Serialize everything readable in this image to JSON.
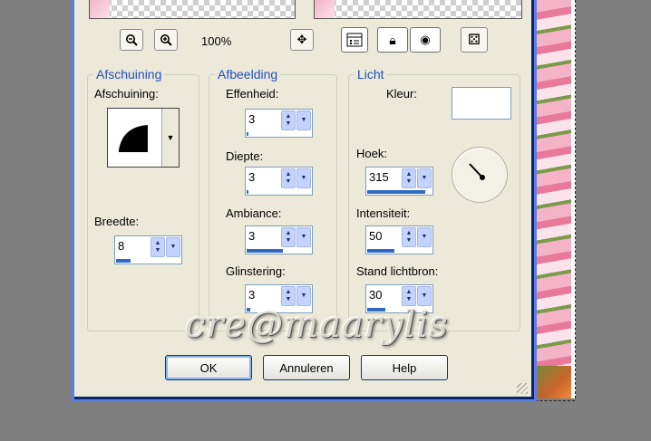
{
  "toolbar": {
    "zoom_level": "100%",
    "icons": [
      "zoom-out-icon",
      "zoom-in-icon",
      "move-icon",
      "proof-icon",
      "lock-eye-icon",
      "eye-icon",
      "random-dice-icon"
    ]
  },
  "bevel_group": {
    "title": "Afschuining",
    "shape_label": "Afschuining:",
    "width_label": "Breedte:",
    "width_value": "8"
  },
  "image_group": {
    "title": "Afbeelding",
    "smoothness_label": "Effenheid:",
    "smoothness_value": "3",
    "depth_label": "Diepte:",
    "depth_value": "3",
    "ambiance_label": "Ambiance:",
    "ambiance_value": "3",
    "shininess_label": "Glinstering:",
    "shininess_value": "3"
  },
  "light_group": {
    "title": "Licht",
    "color_label": "Kleur:",
    "color_value": "#ffffff",
    "angle_label": "Hoek:",
    "angle_value": "315",
    "intensity_label": "Intensiteit:",
    "intensity_value": "50",
    "elevation_label": "Stand lichtbron:",
    "elevation_value": "30"
  },
  "buttons": {
    "ok": "OK",
    "cancel": "Annuleren",
    "help": "Help"
  },
  "watermark": "cre@maarylis",
  "colors": {
    "group_title": "#1f4fbf",
    "dialog_border": "#5e7fe0",
    "spin_bar": "#316ac5"
  }
}
